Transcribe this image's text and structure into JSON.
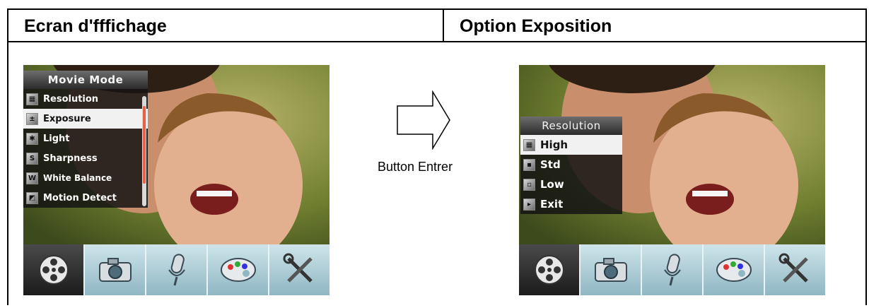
{
  "header": {
    "left_title": "Ecran d'fffichage",
    "right_title": "Option Exposition"
  },
  "left_screen": {
    "menu_title": "Movie Mode",
    "items": [
      {
        "label": "Resolution",
        "icon": "resolution-icon",
        "selected": false
      },
      {
        "label": "Exposure",
        "icon": "exposure-icon",
        "selected": true
      },
      {
        "label": "Light",
        "icon": "light-icon",
        "selected": false
      },
      {
        "label": "Sharpness",
        "icon": "sharpness-icon",
        "selected": false
      },
      {
        "label": "White Balance",
        "icon": "white-balance-icon",
        "selected": false
      },
      {
        "label": "Motion Detect",
        "icon": "motion-detect-icon",
        "selected": false
      }
    ]
  },
  "arrow": {
    "label": "Button Entrer",
    "icon": "right-arrow-icon"
  },
  "right_screen": {
    "menu_title": "Resolution",
    "items": [
      {
        "label": "High",
        "icon": "high-resolution-icon",
        "selected": true
      },
      {
        "label": "Std",
        "icon": "standard-resolution-icon",
        "selected": false
      },
      {
        "label": "Low",
        "icon": "low-resolution-icon",
        "selected": false
      },
      {
        "label": "Exit",
        "icon": "exit-icon",
        "selected": false
      }
    ]
  },
  "tabs": [
    {
      "icon": "film-reel-icon",
      "active": true
    },
    {
      "icon": "camera-icon",
      "active": false
    },
    {
      "icon": "microphone-icon",
      "active": false
    },
    {
      "icon": "palette-icon",
      "active": false
    },
    {
      "icon": "tools-icon",
      "active": false
    }
  ]
}
